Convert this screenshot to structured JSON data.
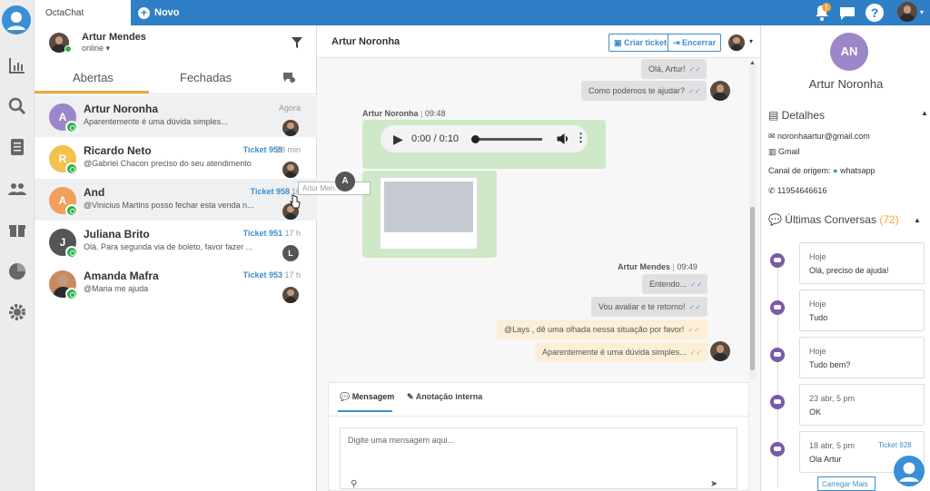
{
  "topbar": {
    "tab_label": "OctaChat",
    "new_label": "Novo",
    "notif_badge": "!"
  },
  "sidebar": {
    "items": [
      "logo-icon",
      "chart-icon",
      "search-icon",
      "list-icon",
      "users-icon",
      "gift-icon",
      "pie-chart-icon",
      "gear-icon"
    ]
  },
  "list": {
    "user": {
      "name": "Artur Mendes",
      "status": "online ▾"
    },
    "tabs": {
      "open": "Abertas",
      "closed": "Fechadas"
    },
    "conversations": [
      {
        "initial": "A",
        "name": "Artur Noronha",
        "ticket": "",
        "time": "Agora",
        "message": "Aparentemente é uma dúvida simples...",
        "color": "#9b86c9"
      },
      {
        "initial": "R",
        "name": "Ricardo Neto",
        "ticket": "Ticket 959",
        "time": "23 min",
        "message": "@Gabriel Chacon preciso do seu atendimento",
        "color": "#f2c14e"
      },
      {
        "initial": "A",
        "name": "And",
        "ticket": "Ticket 958",
        "time": "16",
        "message": "@Vinicius Martins posso fechar esta venda n...",
        "color": "#f0a05a"
      },
      {
        "initial": "J",
        "name": "Juliana Brito",
        "ticket": "Ticket 951",
        "time": "17 h",
        "message": "Olá. Para segunda via de boleto, favor fazer ...",
        "color": "#555555"
      },
      {
        "initial": "",
        "name": "Amanda Mafra",
        "ticket": "Ticket 953",
        "time": "17 h",
        "message": "@Maria me ajuda",
        "color": "#c98a60"
      }
    ],
    "hover_tooltip": "Artur Men...",
    "tooltip_avatar": "A",
    "small_avatar_l": "L"
  },
  "chat": {
    "title": "Artur Noronha",
    "create_ticket": "Criar ticket",
    "close": "Encerrar",
    "messages_top": [
      "Olá, Artur!",
      "Como podemos te ajudar?"
    ],
    "incoming_sender": "Artur Noronha",
    "incoming_time": "09:48",
    "audio": "0:00 / 0:10",
    "outgoing_sender": "Artur Mendes",
    "outgoing_time": "09:49",
    "messages_bottom": [
      "Entendo...",
      "Vou avaliar e te retorno!"
    ],
    "notes": [
      "@Lays , dê uma olhada nessa situação por favor!",
      "Aparentemente é uma dúvida simples..."
    ],
    "compose_tab_message": "Mensagem",
    "compose_tab_note": "Anotação interna",
    "compose_placeholder": "Digite uma mensagem aqui..."
  },
  "details": {
    "initials": "AN",
    "name": "Artur Noronha",
    "section_details": "Detalhes",
    "email": "noronhaartur@gmail.com",
    "company": "Gmail",
    "origin_label": "Canal de origem:",
    "origin_value": "whatsapp",
    "phone": "11954646616",
    "section_last": "Últimas Conversas",
    "last_count": "(72)",
    "last_convs": [
      {
        "date": "Hoje",
        "text": "Olá, preciso de ajuda!",
        "ticket": ""
      },
      {
        "date": "Hoje",
        "text": "Tudo",
        "ticket": ""
      },
      {
        "date": "Hoje",
        "text": "Tudo bem?",
        "ticket": ""
      },
      {
        "date": "23 abr, 5 pm",
        "text": "OK",
        "ticket": ""
      },
      {
        "date": "18 abr, 5 pm",
        "text": "Ola Artur",
        "ticket": "Ticket 928"
      }
    ],
    "load_more": "Carregar Mais"
  },
  "colors": {
    "primary": "#2f7fc6",
    "accent": "#f0a73a",
    "whatsapp": "#2bb24c"
  }
}
